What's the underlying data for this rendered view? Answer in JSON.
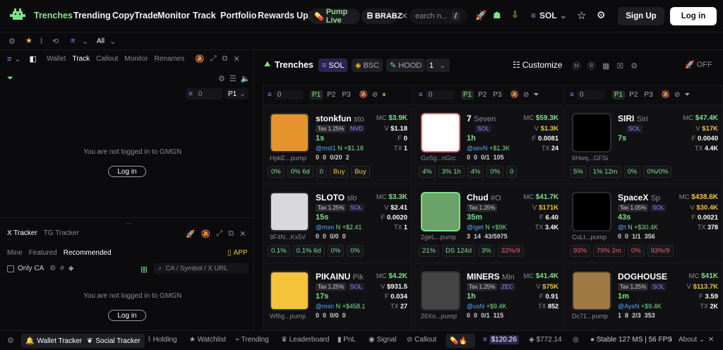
{
  "nav": {
    "items": [
      "Trenches",
      "Trending",
      "CopyTrade",
      "Monitor",
      "Track",
      "Portfolio",
      "Rewards",
      "Up/"
    ],
    "pump_live": "Pump Live",
    "brabz": "BRABZ",
    "search_placeholder": "earch n...",
    "search_hotkey": "/",
    "chain": "SOL",
    "signup": "Sign Up",
    "login": "Log in"
  },
  "subbar": {
    "all": "All"
  },
  "wallet": {
    "tabs": [
      "Wallet",
      "Track",
      "Callout",
      "Monitor",
      "Renames"
    ],
    "active_tab": "Track",
    "count": "0",
    "page": "P1",
    "msg": "You are not logged in to GMGN",
    "login": "Log in"
  },
  "xtracker": {
    "tabs": [
      "X Tracker",
      "TG Tracker"
    ],
    "filters": [
      "Mine",
      "Featured",
      "Recommended"
    ],
    "app": "APP",
    "only_ca": "Only CA",
    "search_placeholder": "CA / Symbol / X URL",
    "msg": "You are not logged in to GMGN",
    "login": "Log in"
  },
  "trenches": {
    "title": "Trenches",
    "chains": [
      "SOL",
      "BSC",
      "HOOD"
    ],
    "page": "1",
    "customize": "Customize",
    "off": "OFF",
    "columns": [
      {
        "count": "0",
        "pages": [
          "P1",
          "P2",
          "P3"
        ],
        "cards": [
          {
            "name": "stonkfun",
            "sub": "sto",
            "tax": "Tax 1.25%",
            "chain": "NVD",
            "age": "1s",
            "mc": "$3.9K",
            "v": "$1.18",
            "f": "0",
            "tx": "1",
            "l3": "@mst1",
            "l3b": "N +$1.18",
            "l4": "0",
            "l4b": "0",
            "l4c": "0/20",
            "l4d": "2",
            "addr": "HpkE...pump",
            "t1": "0%",
            "t2": "0% 6d",
            "t3": "0",
            "buy1": "Buy",
            "buy2": "Buy",
            "color": "#e5932d"
          },
          {
            "name": "SLOTO",
            "sub": "slo",
            "tax": "Tax 1.25%",
            "chain": "SOL",
            "age": "15s",
            "mc": "$3.3K",
            "v": "$2.41",
            "f": "0.0020",
            "tx": "1",
            "l3": "@msn",
            "l3b": "N +$2.41",
            "l4": "0",
            "l4b": "0",
            "l4c": "0/0",
            "l4d": "0",
            "addr": "9F4N...Kx5V",
            "t1": "0.1%",
            "t2": "0.1% 6d",
            "t3": "0%",
            "t4": "0%",
            "color": "#d9d9dd"
          },
          {
            "name": "PIKAINU",
            "sub": "Pik",
            "tax": "Tax 1.25%",
            "chain": "SOL",
            "age": "17s",
            "mc": "$4.2K",
            "v": "$931.5",
            "f": "0.034",
            "tx": "27",
            "l3": "@msn",
            "l3b": "N +$458.1",
            "l4": "0",
            "l4b": "0",
            "l4c": "0/0",
            "l4d": "0",
            "addr": "Wf6g...pump",
            "color": "#f3c43b"
          }
        ]
      },
      {
        "count": "0",
        "pages": [
          "P1",
          "P2",
          "P3"
        ],
        "cards": [
          {
            "name": "7",
            "sub": "Seven",
            "tax": "",
            "chain": "SOL",
            "age": "1h",
            "mc": "$59.3K",
            "v": "$1.3K",
            "f": "0.0081",
            "tx": "24",
            "l3": "@sevN",
            "l3b": "+$1.3K",
            "l4": "0",
            "l4b": "0",
            "l4c": "0/1",
            "l4d": "105",
            "addr": "GvSg...nGrc",
            "t1": "4%",
            "t2": "3% 1h",
            "t3": "4%",
            "t4": "0%",
            "t5": "0",
            "color": "#ffffff"
          },
          {
            "name": "Chud",
            "sub": "#O",
            "tax": "Tax 1.25%",
            "chain": "",
            "age": "35m",
            "mc": "$41.7K",
            "v": "$171K",
            "f": "6.40",
            "tx": "3.4K",
            "l3": "@iget",
            "l3b": "N +$9K",
            "l4": "3",
            "l4b": "14",
            "l4c": "43/5975",
            "l4d": "",
            "addr": "2geL...pump",
            "t1": "21%",
            "t2": "DS 124d",
            "t3": "3%",
            "t4": "32%/9",
            "color": "#6aa36a"
          },
          {
            "name": "MINERS",
            "sub": "Min",
            "tax": "Tax 1.25%",
            "chain": "ZEC",
            "age": "1h",
            "mc": "$41.4K",
            "v": "$75K",
            "f": "0.91",
            "tx": "852",
            "l3": "@usN",
            "l3b": "+$9.4K",
            "l4": "0",
            "l4b": "0",
            "l4c": "0/1",
            "l4d": "115",
            "addr": "26Xo...pump",
            "color": "#444"
          }
        ]
      },
      {
        "count": "0",
        "pages": [
          "P1",
          "P2",
          "P3"
        ],
        "cards": [
          {
            "name": "SIRI",
            "sub": "Siri",
            "tax": "",
            "chain": "SOL",
            "age": "7s",
            "mc": "$47.4K",
            "v": "$17K",
            "f": "0.0040",
            "tx": "4.4K",
            "l3": "",
            "l3b": "",
            "l4": "",
            "l4b": "",
            "l4c": "",
            "l4d": "",
            "addr": "6Hwq...GFSi",
            "t1": "5%",
            "t2": "1% 12m",
            "t3": "0%",
            "t4": "0%/0%",
            "color": "#000"
          },
          {
            "name": "SpaceX",
            "sub": "Sp",
            "tax": "Tax 1.05%",
            "chain": "SOL",
            "age": "43s",
            "mc": "$438.6K",
            "v": "$30.4K",
            "f": "0.0021",
            "tx": "378",
            "l3": "@t",
            "l3b": "N +$30.4K",
            "l4": "0",
            "l4b": "0",
            "l4c": "1/1",
            "l4d": "356",
            "addr": "CuLt...pump",
            "t1": "93%",
            "t2": "79% 2m",
            "t3": "0%",
            "t4": "93%/9",
            "color": "#000"
          },
          {
            "name": "DOGHOUSE",
            "sub": "",
            "tax": "Tax 1.25%",
            "chain": "SOL",
            "age": "1m",
            "mc": "$41K",
            "v": "$113.7K",
            "f": "3.59",
            "tx": "2K",
            "l3": "@AysN",
            "l3b": "+$9.4K",
            "l4": "1",
            "l4b": "8",
            "l4c": "2/3",
            "l4d": "353",
            "addr": "Dc71...pump",
            "color": "#a07a45"
          }
        ]
      }
    ]
  },
  "footer": {
    "wallet_tracker": "Wallet Tracker",
    "social_tracker": "Social Tracker",
    "holding": "Holding",
    "watchlist": "Watchlist",
    "trending": "Trending",
    "leaderboard": "Leaderboard",
    "pnl": "PnL",
    "signal": "Signal",
    "callout": "Callout",
    "sol_price": "$120.26",
    "bnb_price": "$772.14",
    "status": "Stable 127 MS | 56 FPS",
    "about": "About"
  }
}
